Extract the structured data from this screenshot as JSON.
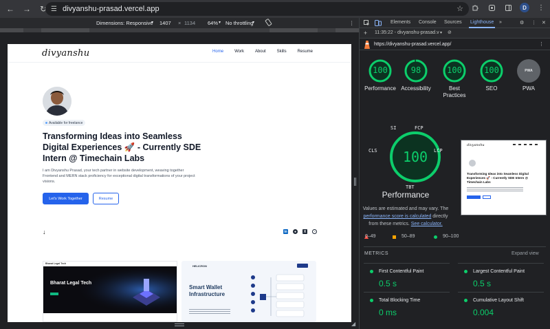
{
  "browser": {
    "url": "divyanshu-prasad.vercel.app",
    "profile_initial": "D"
  },
  "device_toolbar": {
    "dimensions_label": "Dimensions: Responsive",
    "width": "1407",
    "times": "×",
    "height": "1134",
    "zoom": "64%",
    "throttling": "No throttling"
  },
  "site": {
    "logo": "divyanshu",
    "nav": [
      "Home",
      "Work",
      "About",
      "Skills",
      "Resume"
    ],
    "badge": "Available for freelance",
    "title": "Transforming Ideas into Seamless Digital Experiences 🚀 - Currently SDE Intern @ Timechain Labs",
    "description": "I am Divyanshu Prasad, your tech partner in website development, weaving together Frontend and MERN stack proficiency for exceptional digital transformations of your project visions.",
    "primary_button": "Let's Work Together",
    "secondary_button": "Resume",
    "social_icons": [
      "in",
      "gh",
      "X",
      "lc"
    ],
    "projects": [
      {
        "title": "Bharat Legal Tech"
      },
      {
        "brand": "HELICRON",
        "title": "Smart Wallet Infrastructure"
      }
    ]
  },
  "devtools": {
    "tabs": [
      "Elements",
      "Console",
      "Sources",
      "Lighthouse"
    ],
    "more": "»",
    "session": "11:35:22 - divyanshu-prasad.v",
    "report_url": "https://divyanshu-prasad.vercel.app/",
    "scores": [
      {
        "label": "Performance",
        "value": "100",
        "fraction": 1.0
      },
      {
        "label": "Accessibility",
        "value": "98",
        "fraction": 0.98
      },
      {
        "label": "Best Practices",
        "value": "100",
        "fraction": 1.0
      },
      {
        "label": "SEO",
        "value": "100",
        "fraction": 1.0
      }
    ],
    "pwa": {
      "label": "PWA",
      "badge": "PWA"
    },
    "perf_gauge": {
      "value": "100",
      "title": "Performance",
      "metric_labels": [
        "SI",
        "FCP",
        "CLS",
        "LCP",
        "TBT"
      ]
    },
    "note": {
      "before": "Values are estimated and may vary. The ",
      "link1": "performance score is calculated",
      "middle": " directly from these metrics. ",
      "link2": "See calculator."
    },
    "thumbnail": {
      "logo": "divyanshu",
      "title": "Transforming Ideas into Seamless Digital Experiences 🚀 - Currently SDE Intern @ Timechain Labs"
    },
    "legend": [
      "0–49",
      "50–89",
      "90–100"
    ],
    "metrics_header": "METRICS",
    "expand": "Expand view",
    "metrics": [
      {
        "name": "First Contentful Paint",
        "value": "0.5 s"
      },
      {
        "name": "Largest Contentful Paint",
        "value": "0.5 s"
      },
      {
        "name": "Total Blocking Time",
        "value": "0 ms"
      },
      {
        "name": "Cumulative Layout Shift",
        "value": "0.004"
      }
    ],
    "colors": {
      "pass": "#0cce6b",
      "average": "#ffa400",
      "fail": "#ff4e42",
      "link": "#8ab4f8"
    }
  }
}
